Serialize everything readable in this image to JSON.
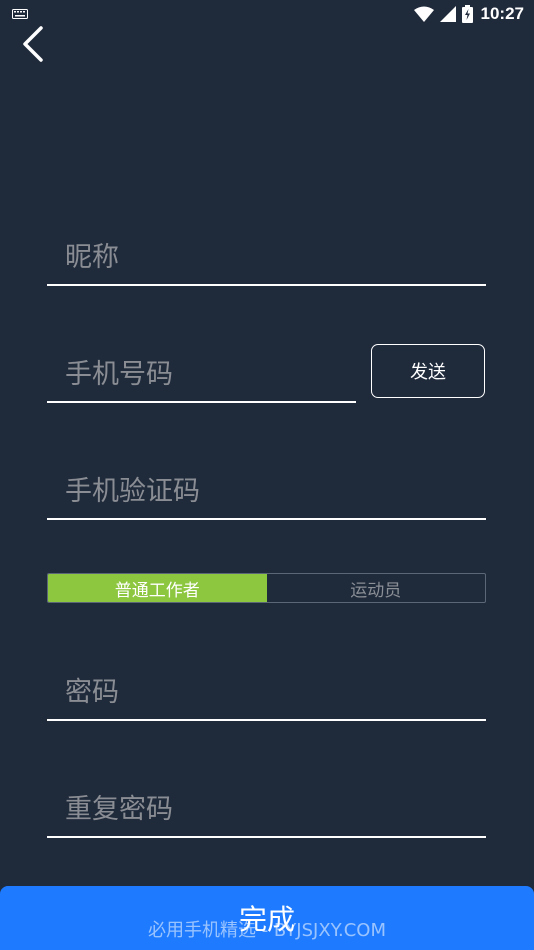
{
  "status_bar": {
    "time": "10:27",
    "icons": [
      "keyboard-icon",
      "wifi-icon",
      "signal-icon",
      "battery-charging-icon"
    ]
  },
  "nav": {
    "back_icon": "chevron-left-icon"
  },
  "form": {
    "nickname_placeholder": "昵称",
    "phone_placeholder": "手机号码",
    "send_code_label": "发送",
    "code_placeholder": "手机验证码",
    "password_placeholder": "密码",
    "confirm_password_placeholder": "重复密码"
  },
  "role_segment": {
    "options": [
      "普通工作者",
      "运动员"
    ],
    "selected": "普通工作者",
    "active_color": "#8dc63f"
  },
  "done_label": "完成",
  "watermark": "必用手机精选 - BYJSJXY.COM",
  "colors": {
    "background": "#1f2a3b",
    "primary_button": "#1e7bff"
  }
}
